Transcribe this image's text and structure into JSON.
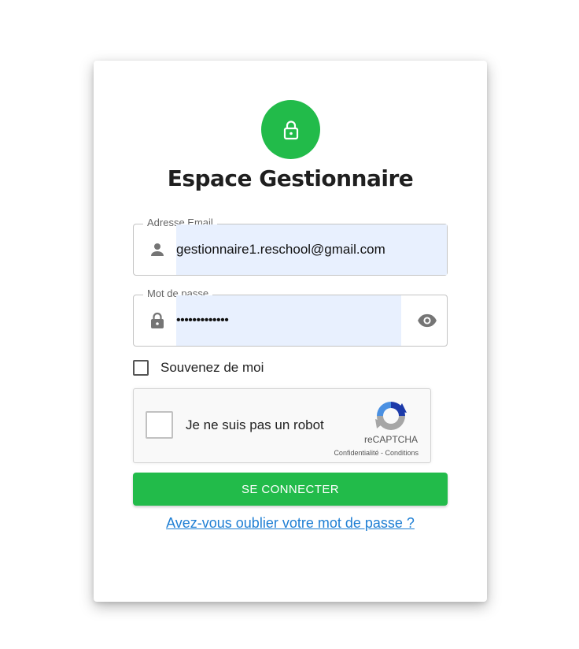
{
  "header": {
    "title": "Espace Gestionnaire",
    "avatar_icon": "lock-icon",
    "accent_color": "#22bb4a"
  },
  "form": {
    "email": {
      "legend": "Adresse Email",
      "value": "gestionnaire1.reschool@gmail.com",
      "icon": "person-icon"
    },
    "password": {
      "legend": "Mot de passe",
      "value": "•••••••••••••",
      "icon": "lock-icon",
      "toggle_icon": "eye-icon"
    },
    "remember": {
      "label": "Souvenez de moi",
      "checked": false
    },
    "recaptcha": {
      "label": "Je ne suis pas un robot",
      "brand": "reCAPTCHA",
      "links": "Confidentialité - Conditions"
    },
    "submit_label": "SE CONNECTER",
    "forgot_link": "Avez-vous oublier votre mot de passe ?"
  }
}
